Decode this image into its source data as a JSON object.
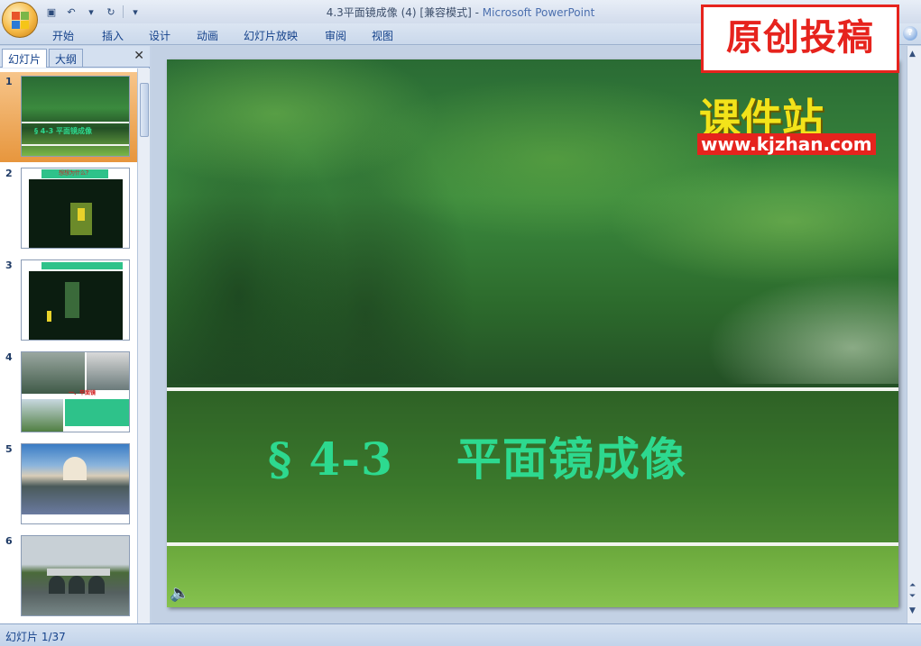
{
  "window": {
    "title": "4.3平面镜成像 (4) [兼容模式]",
    "app_name": "Microsoft PowerPoint"
  },
  "ribbon_tabs": [
    "开始",
    "插入",
    "设计",
    "动画",
    "幻灯片放映",
    "审阅",
    "视图"
  ],
  "watermark": "原创投稿",
  "left_panel": {
    "tabs": [
      "幻灯片",
      "大纲"
    ],
    "close_label": "✕",
    "slides": [
      {
        "num": "1",
        "caption": "§ 4-3   平面镜成像",
        "selected": true
      },
      {
        "num": "2",
        "caption": "想想为什么？"
      },
      {
        "num": "3",
        "caption": ""
      },
      {
        "num": "4",
        "caption": "一、平面镜"
      },
      {
        "num": "5",
        "caption": ""
      },
      {
        "num": "6",
        "caption": ""
      }
    ]
  },
  "slide": {
    "title_num": "§ 4-3",
    "title_text": "平面镜成像",
    "logo_text": "课件站",
    "logo_url": "www.kjzhan.com"
  },
  "status": {
    "slide_counter": "幻灯片 1/37"
  },
  "colors": {
    "accent_red": "#e6231d",
    "title_green": "#2dd98f",
    "logo_yellow": "#f3e31a",
    "selected_thumb": "#e7963d"
  }
}
